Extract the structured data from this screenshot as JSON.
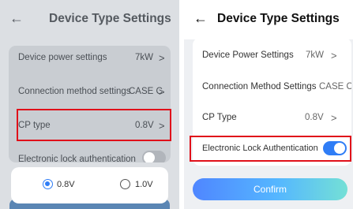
{
  "left": {
    "title": "Device Type Settings",
    "rows": [
      {
        "label": "Device power settings",
        "value": "7kW"
      },
      {
        "label": "Connection method settings",
        "value": "CASE C"
      },
      {
        "label": "CP type",
        "value": "0.8V"
      },
      {
        "label": "Electronic lock authentication"
      }
    ],
    "lock_toggle_on": false,
    "options": [
      {
        "label": "0.8V",
        "selected": true
      },
      {
        "label": "1.0V",
        "selected": false
      }
    ]
  },
  "right": {
    "title": "Device Type Settings",
    "rows": [
      {
        "label": "Device Power Settings",
        "value": "7kW"
      },
      {
        "label": "Connection Method Settings",
        "value": "CASE C"
      },
      {
        "label": "CP Type",
        "value": "0.8V"
      },
      {
        "label": "Electronic Lock Authentication"
      }
    ],
    "lock_toggle_on": true,
    "confirm_label": "Confirm"
  },
  "chevron_glyph": ">",
  "back_glyph": "←",
  "colors": {
    "highlight_border": "#e0101a",
    "toggle_on": "#2f7df6",
    "accent": "#4f86ff"
  }
}
